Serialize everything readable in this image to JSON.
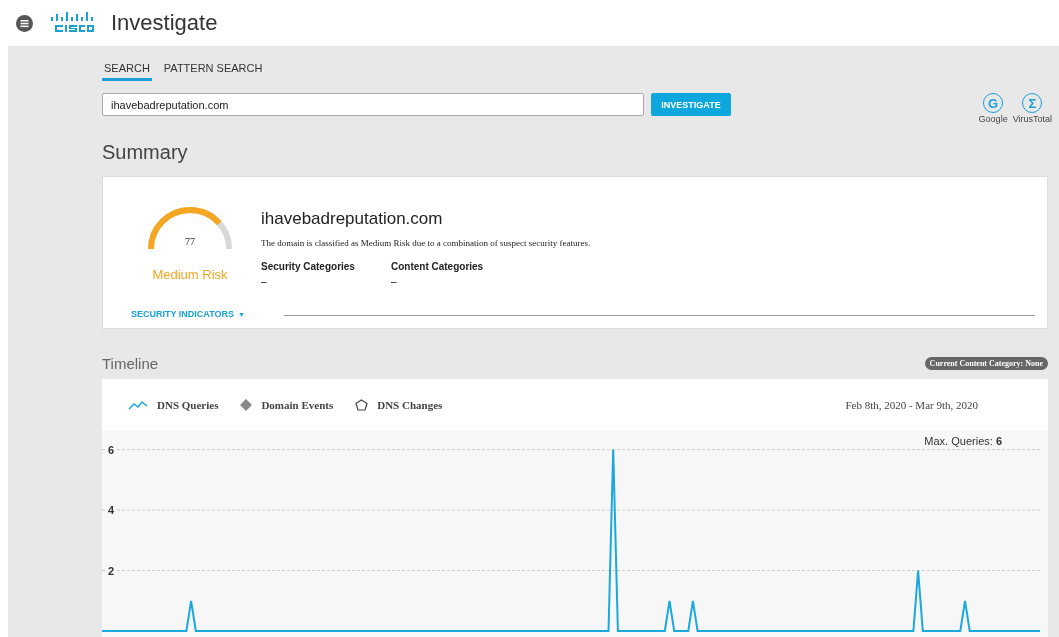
{
  "header": {
    "app_name": "Investigate"
  },
  "search": {
    "tabs": [
      {
        "label": "SEARCH",
        "selected": true
      },
      {
        "label": "PATTERN SEARCH",
        "selected": false
      }
    ],
    "query": "ihavebadreputation.com",
    "button": "INVESTIGATE",
    "links": [
      {
        "letter": "G",
        "label": "Google"
      },
      {
        "letter": "Σ",
        "label": "VirusTotal"
      }
    ]
  },
  "summary": {
    "title": "Summary",
    "score": "77",
    "risk": "Medium Risk",
    "domain": "ihavebadreputation.com",
    "description": "The domain is classified as Medium Risk due to a combination of suspect security features.",
    "categories": [
      {
        "label": "Security Categories",
        "value": "–"
      },
      {
        "label": "Content Categories",
        "value": "–"
      }
    ],
    "indicators": "SECURITY INDICATORS",
    "indicators_caret": "▼"
  },
  "timeline": {
    "title": "Timeline",
    "badge": "Current Content Category: None",
    "legend": [
      {
        "kind": "line"
      },
      {
        "kind": "diamond",
        "label": "Domain Events"
      },
      {
        "kind": "pentagon",
        "label": "DNS Changes"
      }
    ],
    "date_range": "Feb 8th, 2020 - Mar 9th, 2020",
    "max_label": "Max. Queries: **6**",
    "chart_data": {
      "type": "line",
      "categories": [
        null,
        null,
        null,
        null,
        null,
        null,
        null,
        null,
        null,
        null,
        null,
        null,
        null,
        null,
        null,
        null,
        null,
        null,
        null,
        null,
        null,
        null,
        null,
        null,
        null,
        null,
        null,
        null,
        null,
        null,
        null,
        null,
        null,
        null,
        null,
        null,
        null,
        null,
        null,
        null,
        null,
        null,
        null,
        null,
        null,
        null,
        null,
        null,
        null,
        null,
        null,
        null,
        null,
        null,
        null,
        null,
        null,
        null,
        null,
        null,
        null,
        null,
        null,
        null,
        null,
        null,
        null,
        null,
        null,
        null,
        null,
        null,
        null,
        null,
        null,
        null,
        null,
        null,
        null,
        null,
        null,
        null,
        null,
        null,
        null,
        null,
        null,
        null,
        null,
        null,
        null,
        null,
        null,
        null,
        null,
        null,
        null,
        null,
        null,
        null,
        null,
        null,
        null,
        null,
        null,
        null,
        null,
        null,
        null,
        null,
        null,
        null,
        null,
        null,
        null,
        null,
        null,
        null,
        null,
        null,
        null,
        null,
        null,
        null,
        null,
        null,
        null,
        null,
        null,
        null,
        null,
        null,
        null,
        null,
        null,
        null,
        null,
        null,
        null,
        null,
        null,
        null,
        null,
        null,
        null,
        null,
        null,
        null,
        null,
        null,
        null,
        null,
        null,
        null,
        null,
        null,
        null,
        null,
        null,
        null,
        null,
        null,
        null,
        null,
        null,
        null,
        null,
        null,
        null,
        null,
        null,
        null,
        null,
        null,
        null,
        null,
        null,
        null,
        null,
        null,
        null,
        null,
        null,
        null,
        null,
        null,
        null,
        null,
        null,
        null,
        null,
        null,
        null,
        null,
        null,
        null,
        null,
        null,
        null,
        null,
        null
      ],
      "ylim": [
        -0.397,
        8.337
      ],
      "yticks": [
        2,
        4,
        6
      ],
      "grid": true,
      "series": [
        {
          "name": "DNS Queries",
          "color": "#1ba8dc",
          "values": [
            0,
            0,
            0,
            0,
            0,
            0,
            0,
            0,
            0,
            0,
            0,
            0,
            0,
            0,
            0,
            0,
            0,
            0,
            0,
            1,
            0,
            0,
            0,
            0,
            0,
            0,
            0,
            0,
            0,
            0,
            0,
            0,
            0,
            0,
            0,
            0,
            0,
            0,
            0,
            0,
            0,
            0,
            0,
            0,
            0,
            0,
            0,
            0,
            0,
            0,
            0,
            0,
            0,
            0,
            0,
            0,
            0,
            0,
            0,
            0,
            0,
            0,
            0,
            0,
            0,
            0,
            0,
            0,
            0,
            0,
            0,
            0,
            0,
            0,
            0,
            0,
            0,
            0,
            0,
            0,
            0,
            0,
            0,
            0,
            0,
            0,
            0,
            0,
            0,
            0,
            0,
            0,
            0,
            0,
            0,
            0,
            0,
            0,
            0,
            0,
            0,
            0,
            0,
            0,
            0,
            0,
            0,
            0,
            0,
            6,
            0,
            0,
            0,
            0,
            0,
            0,
            0,
            0,
            0,
            0,
            0,
            1,
            0,
            0,
            0,
            0,
            1,
            0,
            0,
            0,
            0,
            0,
            0,
            0,
            0,
            0,
            0,
            0,
            0,
            0,
            0,
            0,
            0,
            0,
            0,
            0,
            0,
            0,
            0,
            0,
            0,
            0,
            0,
            0,
            0,
            0,
            0,
            0,
            0,
            0,
            0,
            0,
            0,
            0,
            0,
            0,
            0,
            0,
            0,
            0,
            0,
            0,
            0,
            0,
            2,
            0,
            0,
            0,
            0,
            0,
            0,
            0,
            0,
            0,
            1,
            0,
            0,
            0,
            0,
            0,
            0,
            0,
            0,
            0,
            0,
            0,
            0,
            0,
            0,
            0,
            0
          ]
        }
      ]
    }
  }
}
